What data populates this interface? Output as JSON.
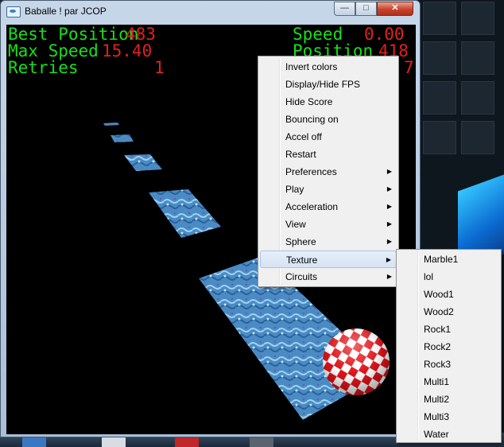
{
  "window": {
    "title": "Baballe ! par JCOP"
  },
  "hud": {
    "best_position_label": "Best Position",
    "best_position_value": "483",
    "max_speed_label": "Max Speed",
    "max_speed_value": "15.40",
    "retries_label": "Retries",
    "retries_value": "1",
    "speed_label": "Speed",
    "speed_value": "0.00",
    "position_label": "Position",
    "position_value": "418",
    "third_value": "7",
    "colors": {
      "label": "#18e018",
      "value": "#e02020"
    }
  },
  "context_menu": {
    "items": [
      {
        "label": "Invert colors",
        "submenu": false
      },
      {
        "label": "Display/Hide FPS",
        "submenu": false
      },
      {
        "label": "Hide Score",
        "submenu": false
      },
      {
        "label": "Bouncing on",
        "submenu": false
      },
      {
        "label": "Accel off",
        "submenu": false
      },
      {
        "label": "Restart",
        "submenu": false
      },
      {
        "label": "Preferences",
        "submenu": true
      },
      {
        "label": "Play",
        "submenu": true
      },
      {
        "label": "Acceleration",
        "submenu": true
      },
      {
        "label": "View",
        "submenu": true
      },
      {
        "label": "Sphere",
        "submenu": true
      },
      {
        "label": "Texture",
        "submenu": true,
        "highlighted": true
      },
      {
        "label": "Circuits",
        "submenu": true
      }
    ],
    "submenu_arrow": "▶"
  },
  "texture_submenu": {
    "items": [
      "Marble1",
      "lol",
      "Wood1",
      "Wood2",
      "Rock1",
      "Rock2",
      "Rock3",
      "Multi1",
      "Multi2",
      "Multi3",
      "Water"
    ]
  }
}
